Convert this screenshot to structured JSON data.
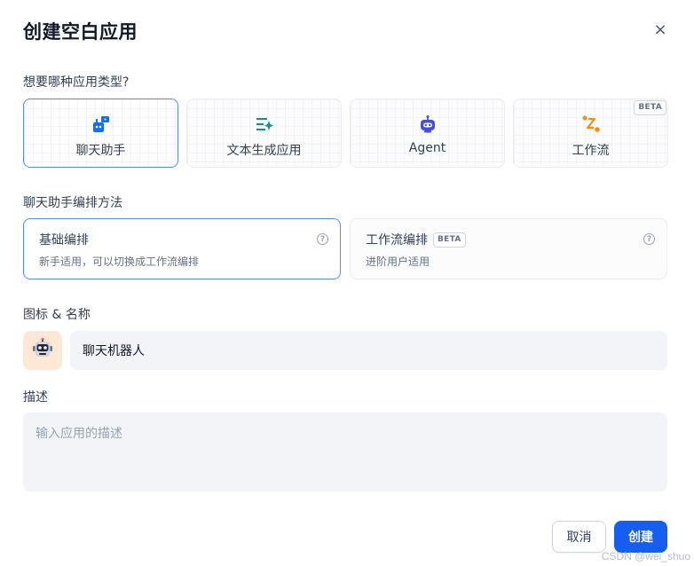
{
  "dialog": {
    "title": "创建空白应用",
    "close_label": "×"
  },
  "app_type": {
    "label": "想要哪种应用类型?",
    "options": [
      {
        "label": "聊天助手",
        "icon": "chat-bot-icon",
        "selected": true
      },
      {
        "label": "文本生成应用",
        "icon": "text-generate-icon",
        "selected": false
      },
      {
        "label": "Agent",
        "icon": "agent-robot-icon",
        "selected": false
      },
      {
        "label": "工作流",
        "icon": "workflow-icon",
        "selected": false,
        "badge": "BETA"
      }
    ]
  },
  "orchestration": {
    "label": "聊天助手编排方法",
    "options": [
      {
        "title": "基础编排",
        "desc": "新手适用，可以切换成工作流编排",
        "selected": true
      },
      {
        "title": "工作流编排",
        "badge": "BETA",
        "desc": "进阶用户适用",
        "selected": false
      }
    ]
  },
  "icon_name": {
    "label": "图标 & 名称",
    "avatar_icon": "robot-face-icon",
    "name_value": "聊天机器人"
  },
  "description": {
    "label": "描述",
    "placeholder": "输入应用的描述",
    "value": ""
  },
  "actions": {
    "cancel_label": "取消",
    "create_label": "创建"
  },
  "watermark": "CSDN @wei_shuo",
  "colors": {
    "primary": "#155eef",
    "selected_border": "#528bff",
    "avatar_bg": "#fde8d5"
  }
}
